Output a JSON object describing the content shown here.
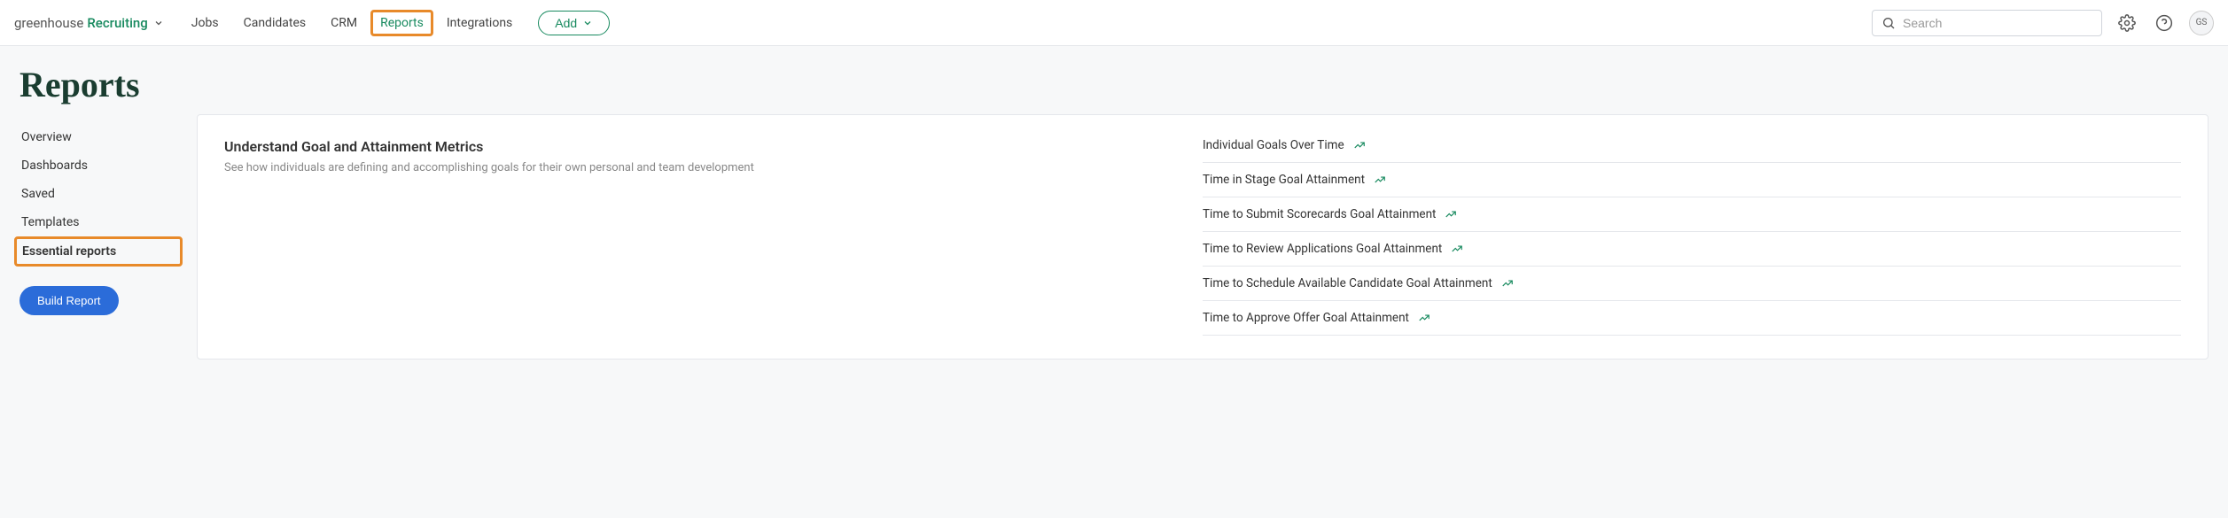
{
  "logo": {
    "brand": "greenhouse",
    "product": "Recruiting"
  },
  "nav": {
    "items": [
      {
        "label": "Jobs"
      },
      {
        "label": "Candidates"
      },
      {
        "label": "CRM"
      },
      {
        "label": "Reports",
        "active": true
      },
      {
        "label": "Integrations"
      }
    ],
    "add_label": "Add"
  },
  "search": {
    "placeholder": "Search"
  },
  "avatar": {
    "initials": "GS"
  },
  "page": {
    "title": "Reports"
  },
  "sidebar": {
    "items": [
      {
        "label": "Overview"
      },
      {
        "label": "Dashboards"
      },
      {
        "label": "Saved"
      },
      {
        "label": "Templates"
      },
      {
        "label": "Essential reports",
        "active": true
      }
    ],
    "build_report_label": "Build Report"
  },
  "panel": {
    "title": "Understand Goal and Attainment Metrics",
    "desc": "See how individuals are defining and accomplishing goals for their own personal and team development",
    "reports": [
      {
        "label": "Individual Goals Over Time"
      },
      {
        "label": "Time in Stage Goal Attainment"
      },
      {
        "label": "Time to Submit Scorecards Goal Attainment"
      },
      {
        "label": "Time to Review Applications Goal Attainment"
      },
      {
        "label": "Time to Schedule Available Candidate Goal Attainment"
      },
      {
        "label": "Time to Approve Offer Goal Attainment"
      }
    ]
  }
}
